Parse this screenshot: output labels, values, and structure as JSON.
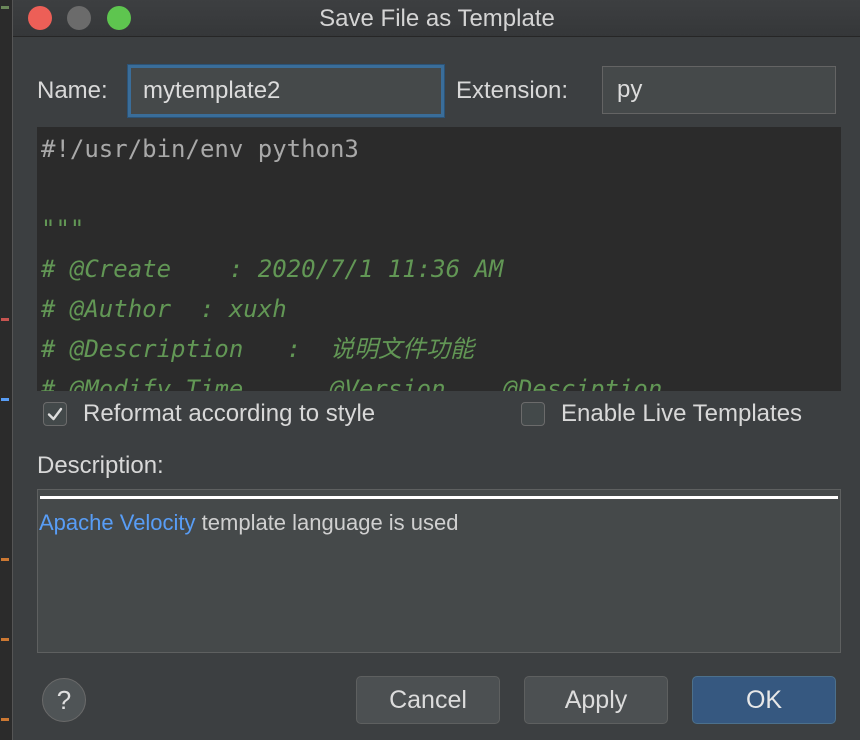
{
  "window": {
    "title": "Save File as Template"
  },
  "form": {
    "name_label": "Name:",
    "name_value": "mytemplate2",
    "extension_label": "Extension:",
    "extension_value": "py"
  },
  "editor": {
    "lines": [
      "#!/usr/bin/env python3",
      "",
      "\"\"\"",
      "# @Create    : 2020/7/1 11:36 AM",
      "# @Author  : xuxh",
      "# @Description   :  说明文件功能",
      "# @Modify Time      @Version    @Desciption"
    ]
  },
  "options": {
    "reformat": {
      "label": "Reformat according to style",
      "checked": true
    },
    "live_templates": {
      "label": "Enable Live Templates",
      "checked": false
    }
  },
  "description": {
    "label": "Description:",
    "link_text": "Apache Velocity",
    "text": " template language is used"
  },
  "buttons": {
    "help": "?",
    "cancel": "Cancel",
    "apply": "Apply",
    "ok": "OK"
  },
  "colors": {
    "accent": "#3a6d99",
    "primary_button": "#365880",
    "link": "#589df6",
    "comment": "#629755",
    "close": "#ed5f57",
    "maximize": "#5ec54f"
  }
}
